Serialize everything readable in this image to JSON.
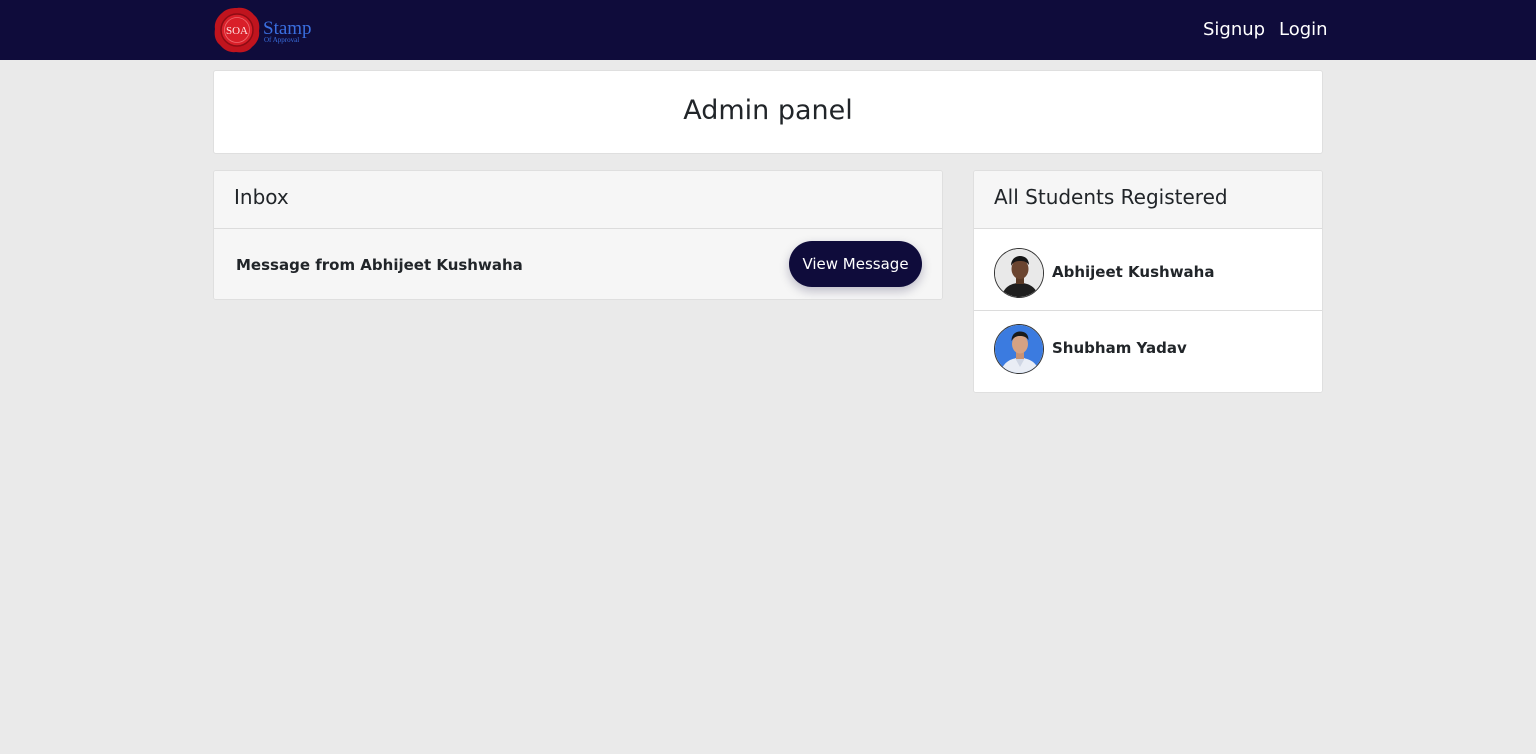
{
  "navbar": {
    "logo_seal_text": "SOA",
    "brand_name": "Stamp",
    "brand_tagline": "Of Approval",
    "links": [
      "Signup",
      "Login"
    ],
    "colors": {
      "background": "#0f0c3b",
      "brand_blue": "#3a6fe0",
      "seal_red": "#c0141e"
    }
  },
  "page": {
    "title": "Admin panel"
  },
  "inbox": {
    "header": "Inbox",
    "messages": [
      {
        "text": "Message from Abhijeet Kushwaha",
        "button_label": "View Message"
      }
    ]
  },
  "students": {
    "header": "All Students Registered",
    "list": [
      {
        "name": "Abhijeet Kushwaha",
        "avatar": "person-photo-icon"
      },
      {
        "name": "Shubham Yadav",
        "avatar": "person-photo-icon"
      }
    ]
  }
}
